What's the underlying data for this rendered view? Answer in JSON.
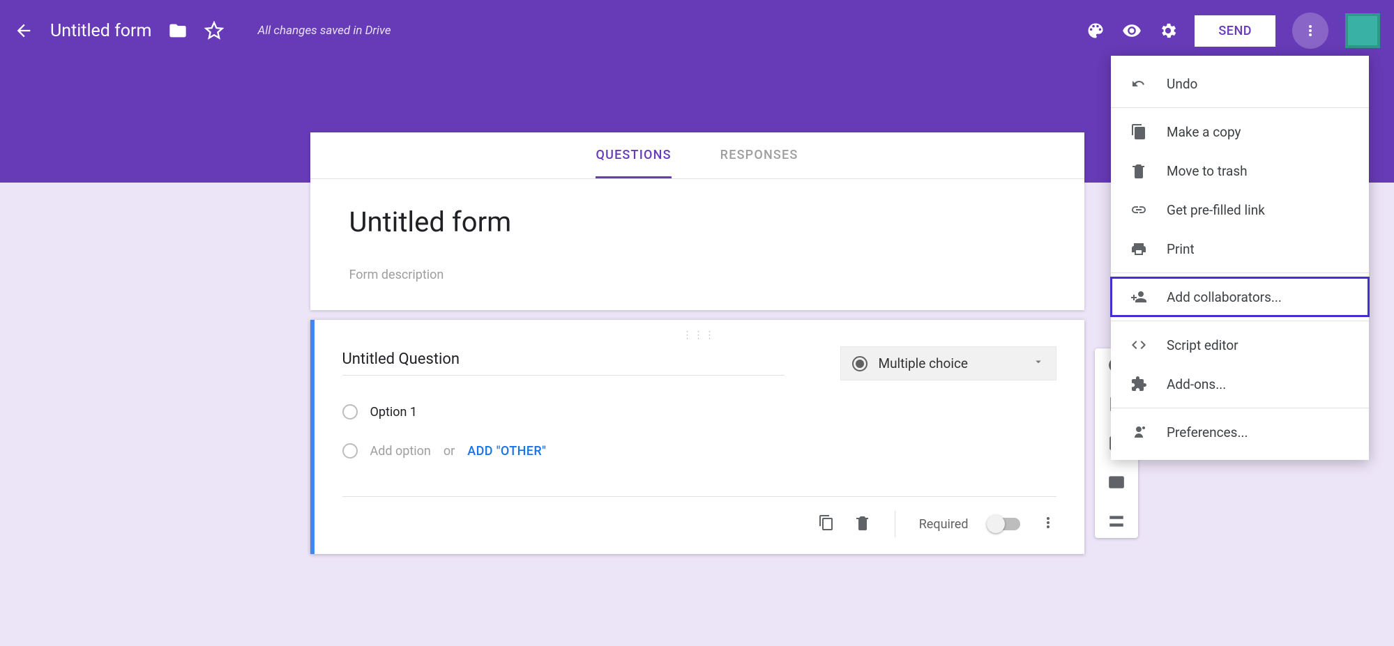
{
  "header": {
    "title": "Untitled form",
    "save_status": "All changes saved in Drive",
    "send_label": "SEND"
  },
  "tabs": {
    "questions": "QUESTIONS",
    "responses": "RESPONSES"
  },
  "form": {
    "title": "Untitled form",
    "description_placeholder": "Form description"
  },
  "question": {
    "title": "Untitled Question",
    "type_label": "Multiple choice",
    "option1": "Option 1",
    "add_option": "Add option",
    "or": "or",
    "add_other": "ADD \"OTHER\"",
    "required_label": "Required"
  },
  "side_tools": {
    "add_question": "add-question",
    "add_title": "add-title",
    "add_image": "add-image",
    "add_video": "add-video",
    "add_section": "add-section"
  },
  "menu": {
    "undo": "Undo",
    "copy": "Make a copy",
    "trash": "Move to trash",
    "prefill": "Get pre-filled link",
    "print": "Print",
    "collab": "Add collaborators...",
    "script": "Script editor",
    "addons": "Add-ons...",
    "prefs": "Preferences..."
  }
}
